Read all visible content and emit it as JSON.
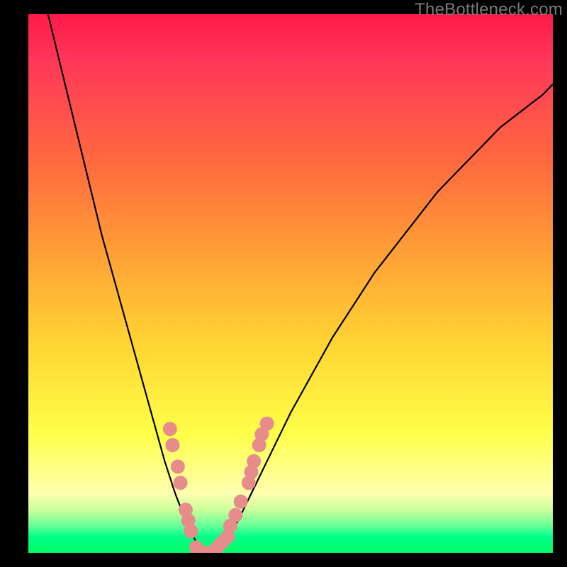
{
  "watermark": "TheBottleneck.com",
  "colors": {
    "curve": "#000000",
    "marker": "#e88b8b",
    "gradient_top": "#ff1a4a",
    "gradient_bottom": "#00ff66"
  },
  "chart_data": {
    "type": "line",
    "title": "",
    "xlabel": "",
    "ylabel": "",
    "xlim": [
      0,
      100
    ],
    "ylim": [
      0,
      100
    ],
    "x": [
      0,
      2,
      4,
      6,
      8,
      10,
      12,
      14,
      16,
      18,
      20,
      22,
      24,
      26,
      28,
      30,
      31,
      32,
      33,
      34,
      35,
      36,
      38,
      40,
      42,
      44,
      46,
      48,
      50,
      54,
      58,
      62,
      66,
      70,
      74,
      78,
      82,
      86,
      90,
      94,
      98,
      100
    ],
    "y": [
      115,
      107,
      99,
      91,
      83,
      75,
      67,
      59,
      52,
      45,
      38,
      31,
      24,
      17,
      11,
      6,
      4,
      2,
      1,
      0,
      0,
      1,
      3,
      6,
      10,
      14,
      18,
      22,
      26,
      33,
      40,
      46,
      52,
      57,
      62,
      67,
      71,
      75,
      79,
      82,
      85,
      87
    ],
    "minimum_x": 34,
    "markers": [
      {
        "x": 27,
        "y": 23
      },
      {
        "x": 27.5,
        "y": 20
      },
      {
        "x": 28.5,
        "y": 16
      },
      {
        "x": 29,
        "y": 13
      },
      {
        "x": 30,
        "y": 8
      },
      {
        "x": 30.5,
        "y": 6
      },
      {
        "x": 31,
        "y": 4
      },
      {
        "x": 32,
        "y": 1
      },
      {
        "x": 33,
        "y": 0
      },
      {
        "x": 34,
        "y": 0
      },
      {
        "x": 35,
        "y": 0
      },
      {
        "x": 36,
        "y": 1
      },
      {
        "x": 37,
        "y": 2
      },
      {
        "x": 38,
        "y": 3
      },
      {
        "x": 38.5,
        "y": 5
      },
      {
        "x": 39.5,
        "y": 7
      },
      {
        "x": 40.5,
        "y": 9.5
      },
      {
        "x": 42,
        "y": 13
      },
      {
        "x": 42.5,
        "y": 15
      },
      {
        "x": 43,
        "y": 17
      },
      {
        "x": 44,
        "y": 20
      },
      {
        "x": 44.5,
        "y": 22
      },
      {
        "x": 45.5,
        "y": 24
      }
    ]
  }
}
